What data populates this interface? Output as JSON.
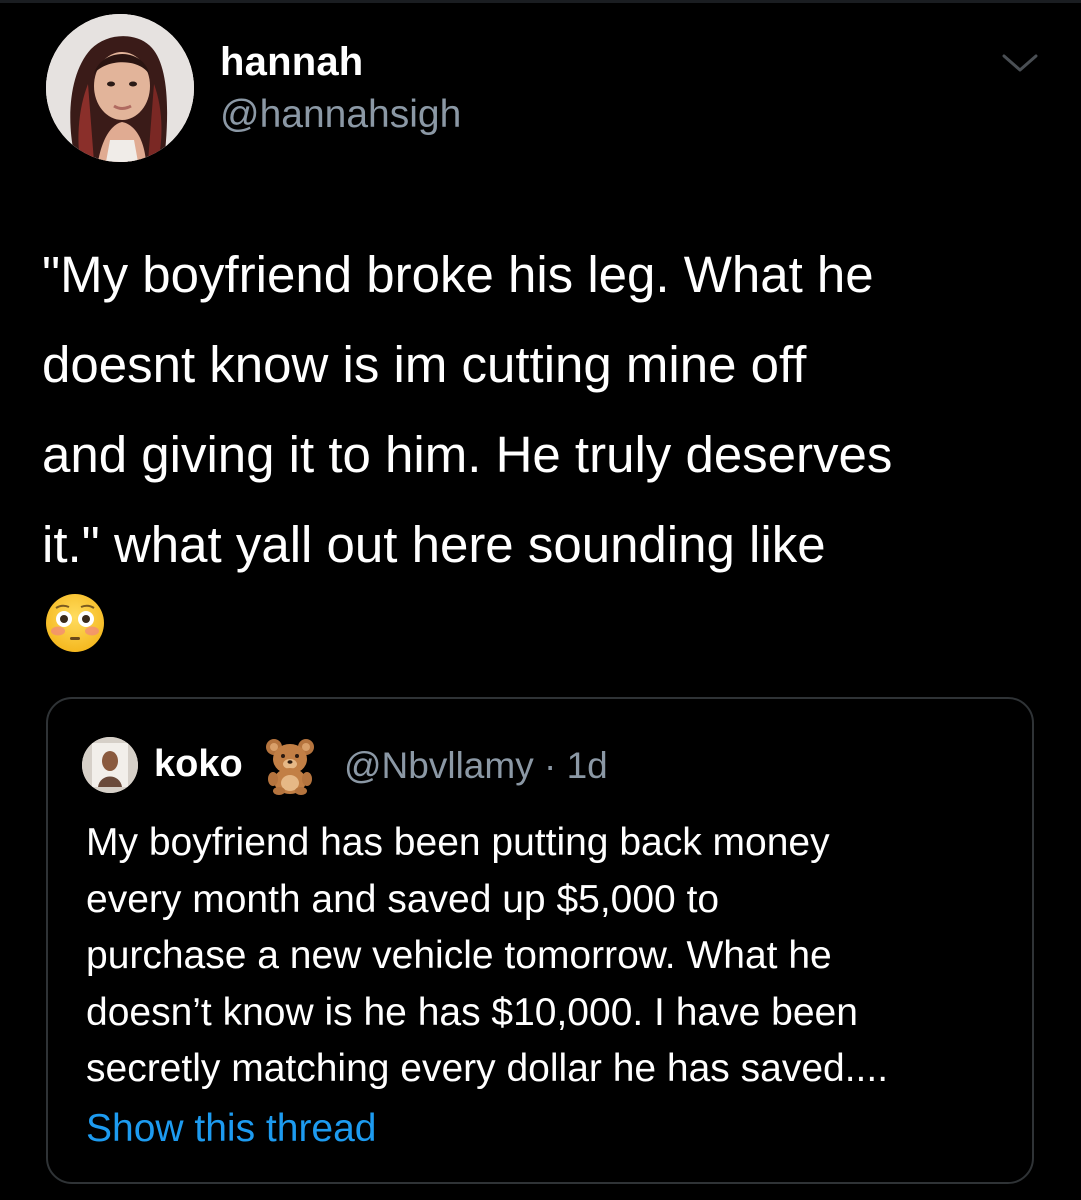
{
  "tweet": {
    "author": {
      "name": "hannah",
      "handle": "@hannahsigh"
    },
    "text_lines": [
      "\"My boyfriend broke his leg. What he",
      "doesnt know is im cutting mine off",
      "and giving it to him. He truly deserves",
      "it.\" what yall out here sounding like"
    ],
    "emoji": "flushed-face"
  },
  "quoted_tweet": {
    "author": {
      "name": "koko",
      "name_emoji": "teddy-bear",
      "handle_time": "@Nbvllamy · 1d"
    },
    "text_lines": [
      "My boyfriend has been putting back money",
      "every month and saved up $5,000 to",
      "purchase a new vehicle tomorrow. What he",
      "doesn’t know is he has $10,000. I have been",
      "secretly matching every dollar he has saved...."
    ],
    "show_thread_label": "Show this thread"
  },
  "colors": {
    "background": "#000000",
    "primary_text": "#ffffff",
    "secondary_text": "#8b98a5",
    "link": "#1d9bf0",
    "border": "#2f3336"
  },
  "icons": {
    "more": "chevron-down-icon",
    "avatar": "profile-photo",
    "quote_avatar": "profile-photo"
  }
}
